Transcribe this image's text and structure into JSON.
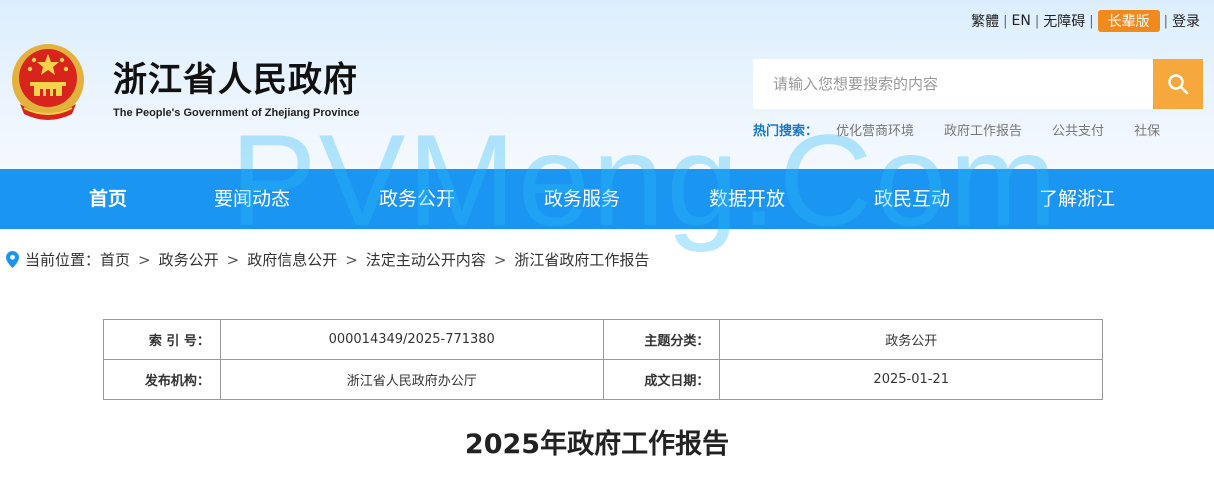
{
  "top_links": {
    "traditional": "繁體",
    "english": "EN",
    "accessibility": "无障碍",
    "elder": "长辈版",
    "login": "登录",
    "separator": "|"
  },
  "site": {
    "title": "浙江省人民政府",
    "subtitle": "The People's Government of Zhejiang Province"
  },
  "search": {
    "placeholder": "请输入您想要搜索的内容",
    "hot_label": "热门搜索：",
    "hot_items": [
      "优化营商环境",
      "政府工作报告",
      "公共支付",
      "社保"
    ]
  },
  "nav": {
    "items": [
      "首页",
      "要闻动态",
      "政务公开",
      "政务服务",
      "数据开放",
      "政民互动",
      "了解浙江"
    ]
  },
  "watermark": "PVMeng.Com",
  "breadcrumb": {
    "label": "当前位置：",
    "items": [
      "首页",
      "政务公开",
      "政府信息公开",
      "法定主动公开内容",
      "浙江省政府工作报告"
    ],
    "separator": ">"
  },
  "meta_table": {
    "index_label": "索 引 号：",
    "index_value": "000014349/2025-771380",
    "topic_label": "主题分类：",
    "topic_value": "政务公开",
    "publisher_label": "发布机构：",
    "publisher_value": "浙江省人民政府办公厅",
    "date_label": "成文日期：",
    "date_value": "2025-01-21"
  },
  "document": {
    "title": "2025年政府工作报告"
  },
  "colors": {
    "nav_bg": "#1b95f2",
    "search_btn": "#f7a83c",
    "elder_badge": "#f08a1d",
    "hot_label": "#1a78c2"
  }
}
